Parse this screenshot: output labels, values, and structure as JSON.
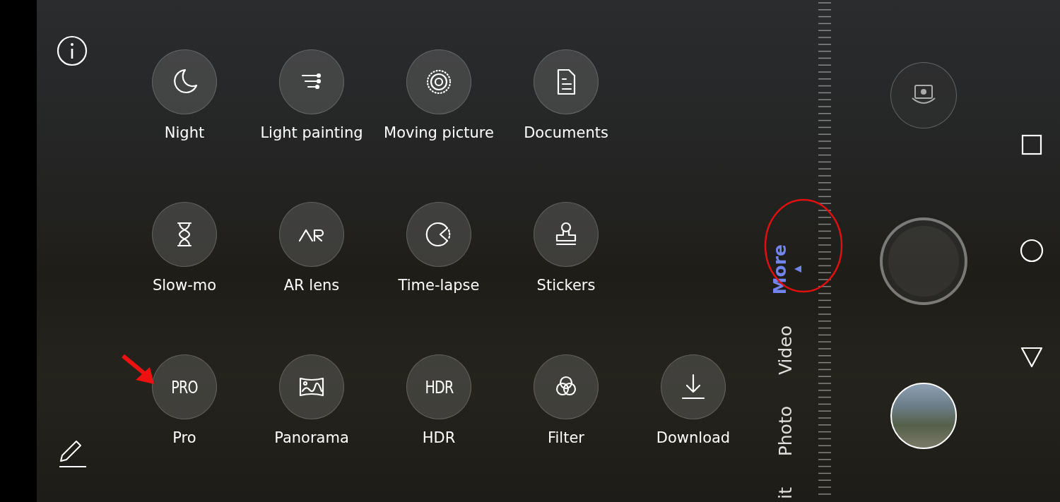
{
  "modes_grid": [
    {
      "items": [
        {
          "label": "Night"
        },
        {
          "label": "Light painting"
        },
        {
          "label": "Moving picture"
        },
        {
          "label": "Documents"
        }
      ]
    },
    {
      "items": [
        {
          "label": "Slow-mo"
        },
        {
          "label": "AR lens"
        },
        {
          "label": "Time-lapse"
        },
        {
          "label": "Stickers"
        }
      ]
    },
    {
      "items": [
        {
          "label": "Pro",
          "icon_text": "PRO"
        },
        {
          "label": "Panorama"
        },
        {
          "label": "HDR",
          "icon_text": "HDR"
        },
        {
          "label": "Filter"
        },
        {
          "label": "Download"
        }
      ]
    }
  ],
  "mode_switcher": [
    {
      "label": "More",
      "selected": true
    },
    {
      "label": "Video",
      "selected": false
    },
    {
      "label": "Photo",
      "selected": false
    },
    {
      "label": "it",
      "selected": false
    }
  ]
}
